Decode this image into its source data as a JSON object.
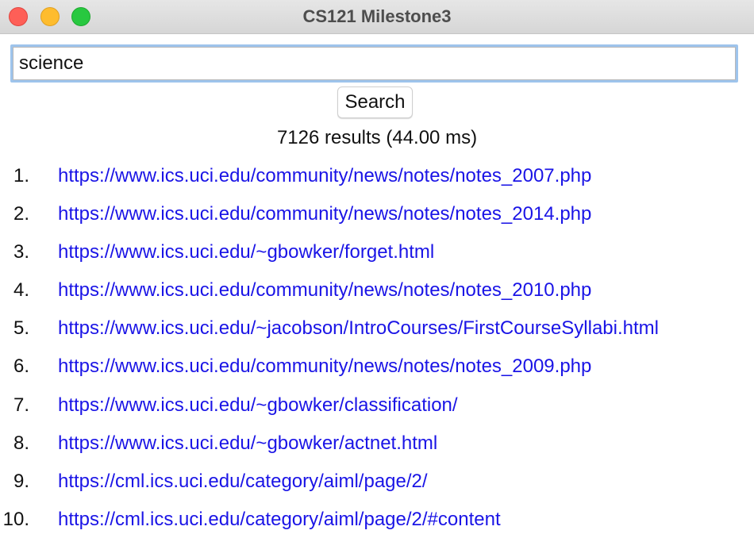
{
  "window": {
    "title": "CS121 Milestone3"
  },
  "search": {
    "value": "science",
    "button_label": "Search"
  },
  "summary": {
    "text": "7126 results (44.00 ms)"
  },
  "results": [
    {
      "num": "1.",
      "url": "https://www.ics.uci.edu/community/news/notes/notes_2007.php"
    },
    {
      "num": "2.",
      "url": "https://www.ics.uci.edu/community/news/notes/notes_2014.php"
    },
    {
      "num": "3.",
      "url": "https://www.ics.uci.edu/~gbowker/forget.html"
    },
    {
      "num": "4.",
      "url": "https://www.ics.uci.edu/community/news/notes/notes_2010.php"
    },
    {
      "num": "5.",
      "url": "https://www.ics.uci.edu/~jacobson/IntroCourses/FirstCourseSyllabi.html"
    },
    {
      "num": "6.",
      "url": "https://www.ics.uci.edu/community/news/notes/notes_2009.php"
    },
    {
      "num": "7.",
      "url": "https://www.ics.uci.edu/~gbowker/classification/"
    },
    {
      "num": "8.",
      "url": "https://www.ics.uci.edu/~gbowker/actnet.html"
    },
    {
      "num": "9.",
      "url": "https://cml.ics.uci.edu/category/aiml/page/2/"
    },
    {
      "num": "10.",
      "url": "https://cml.ics.uci.edu/category/aiml/page/2/#content"
    }
  ],
  "colors": {
    "link": "#1a14e6",
    "focus_ring": "#9ec4ec",
    "close": "#fe5f57",
    "minimize": "#febc2e",
    "maximize": "#28c840"
  }
}
